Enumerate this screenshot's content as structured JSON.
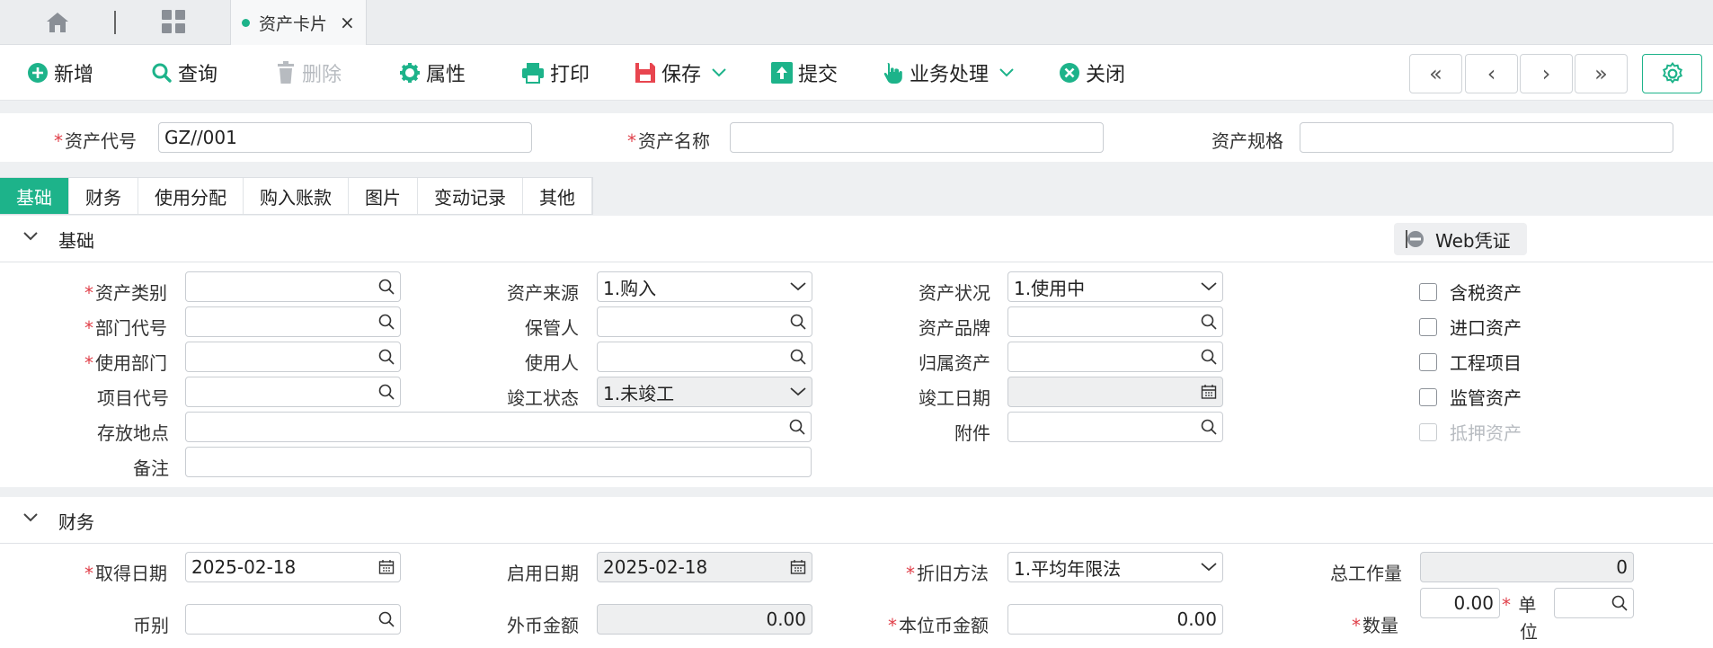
{
  "tabbar": {
    "active_tab": "资产卡片",
    "close_glyph": "×"
  },
  "toolbar": {
    "add": "新增",
    "query": "查询",
    "delete": "删除",
    "properties": "属性",
    "print": "打印",
    "save": "保存",
    "submit": "提交",
    "business": "业务处理",
    "close": "关闭",
    "nav": {
      "first": "«",
      "prev": "‹",
      "next": "›",
      "last": "»"
    }
  },
  "header": {
    "asset_code_label": "资产代号",
    "asset_code_value": "GZ//001",
    "asset_name_label": "资产名称",
    "asset_name_value": "",
    "asset_spec_label": "资产规格",
    "asset_spec_value": ""
  },
  "section_tabs": [
    "基础",
    "财务",
    "使用分配",
    "购入账款",
    "图片",
    "变动记录",
    "其他"
  ],
  "basic": {
    "title": "基础",
    "web_voucher": "Web凭证",
    "asset_category": "资产类别",
    "dept_code": "部门代号",
    "use_dept": "使用部门",
    "project_code": "项目代号",
    "storage_location": "存放地点",
    "remark": "备注",
    "asset_source_label": "资产来源",
    "asset_source_value": "1.购入",
    "custodian": "保管人",
    "user": "使用人",
    "completion_status_label": "竣工状态",
    "completion_status_value": "1.未竣工",
    "asset_status_label": "资产状况",
    "asset_status_value": "1.使用中",
    "asset_brand": "资产品牌",
    "belong_asset": "归属资产",
    "completion_date": "竣工日期",
    "attachment": "附件",
    "checkboxes": [
      "含税资产",
      "进口资产",
      "工程项目",
      "监管资产",
      "抵押资产"
    ]
  },
  "finance": {
    "title": "财务",
    "acquire_date_label": "取得日期",
    "acquire_date_value": "2025-02-18",
    "currency_label": "币别",
    "start_date_label": "启用日期",
    "start_date_value": "2025-02-18",
    "foreign_amount_label": "外币金额",
    "foreign_amount_value": "0.00",
    "depr_method_label": "折旧方法",
    "depr_method_value": "1.平均年限法",
    "local_amount_label": "本位币金额",
    "local_amount_value": "0.00",
    "total_work_label": "总工作量",
    "total_work_value": "0",
    "quantity_label": "数量",
    "quantity_value": "0.00",
    "unit_label_line1": "单",
    "unit_label_line2": "位"
  },
  "colors": {
    "accent": "#1db38a",
    "required": "#e0404a",
    "delete_icon": "#b7bbc0"
  }
}
